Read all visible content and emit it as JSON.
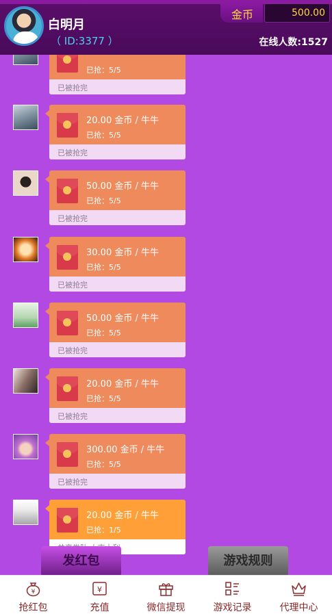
{
  "header": {
    "username": "白明月",
    "user_id": "（ ID:3377 ）",
    "coin_label": "金币",
    "coin_value": "500.00",
    "online": "在线人数:1527"
  },
  "messages": [
    {
      "amount": "",
      "grabbed": "已抢：5/5",
      "status": "已被抢完"
    },
    {
      "amount": "20.00 金币 / 牛牛",
      "grabbed": "已抢：5/5",
      "status": "已被抢完"
    },
    {
      "amount": "50.00 金币 / 牛牛",
      "grabbed": "已抢：5/5",
      "status": "已被抢完"
    },
    {
      "amount": "30.00 金币 / 牛牛",
      "grabbed": "已抢：5/5",
      "status": "已被抢完"
    },
    {
      "amount": "50.00 金币 / 牛牛",
      "grabbed": "已抢：5/5",
      "status": "已被抢完"
    },
    {
      "amount": "20.00 金币 / 牛牛",
      "grabbed": "已抢：5/5",
      "status": "已被抢完"
    },
    {
      "amount": "300.00 金币 / 牛牛",
      "grabbed": "已抢：5/5",
      "status": "已被抢完"
    },
    {
      "amount": "20.00 金币 / 牛牛",
      "grabbed": "已抢：1/5",
      "status": "共享发队 大吉大利"
    }
  ],
  "actions": {
    "send": "发红包",
    "rules": "游戏规则"
  },
  "nav": [
    {
      "label": "抢红包",
      "icon": "money-bag-icon"
    },
    {
      "label": "充值",
      "icon": "yen-ticket-icon"
    },
    {
      "label": "微信提现",
      "icon": "gift-box-icon"
    },
    {
      "label": "游戏记录",
      "icon": "grid-record-icon"
    },
    {
      "label": "代理中心",
      "icon": "crown-icon"
    }
  ],
  "colors": {
    "background": "#b349e3",
    "header": "#4a0a5a",
    "bubble": "#ee8a5c",
    "bubble_active": "#ff9f38",
    "coin": "#ffd83a",
    "id": "#4fd0f0",
    "nav_text": "#8a2a2a"
  }
}
